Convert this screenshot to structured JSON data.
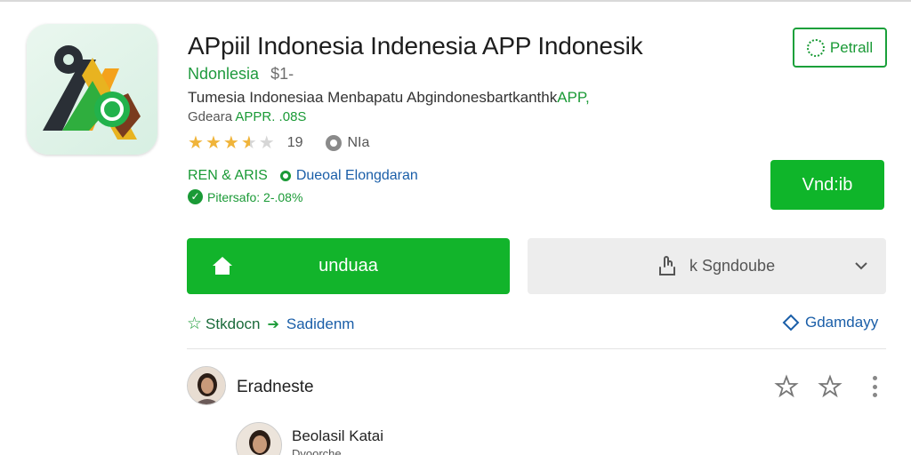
{
  "app": {
    "title": "APpiil Indonesia Indenesia APP Indonesik",
    "developer": "Ndonlesia",
    "price": "$1-",
    "description_prefix": "Tumesia Indonesiaa Menbapatu Abgindonesbartkanthk",
    "description_highlight": "APP,",
    "sub_prefix": "Gdeara ",
    "sub_highlight": "APPR. .08S",
    "rating_stars": 3.5,
    "rating_count": "19",
    "rating_extra": "NIa",
    "tag_green": "REN & ARIS",
    "tag_blue": "Dueoal Elongdaran",
    "verified_text": "Pitersafo: 2-.08%"
  },
  "buttons": {
    "install": "Petrall",
    "unduh_small": "Vnd:ib",
    "main": "unduaa",
    "share": "k Sgndoube"
  },
  "links": {
    "left_first": "Stkdocn",
    "left_second": "Sadidenm",
    "right": "Gdamdayy"
  },
  "reviews": [
    {
      "name": "Eradneste"
    },
    {
      "name": "Beolasil Katai",
      "sub": "Dvoorche"
    }
  ],
  "icons": {
    "app": "app-logo-icon",
    "install": "install-icon",
    "home": "home-icon",
    "share": "share-icon",
    "chevron": "chevron-down-icon",
    "favorite": "star-outline-icon",
    "more": "more-vert-icon"
  },
  "colors": {
    "primary_green": "#12b42b",
    "link_blue": "#1a5ea8",
    "star_gold": "#f0b43a"
  }
}
